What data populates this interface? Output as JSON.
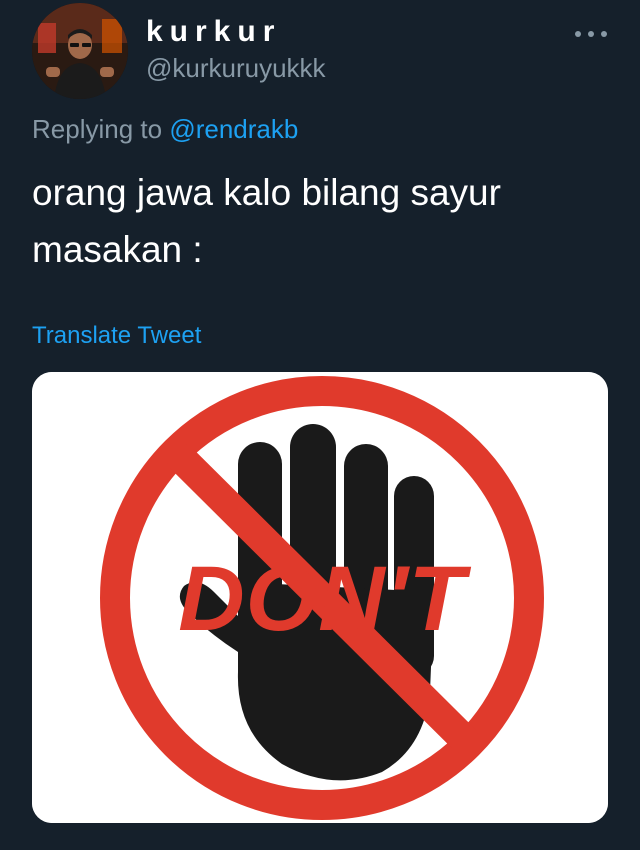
{
  "tweet": {
    "display_name": "kurkur",
    "handle": "@kurkuruyukkk",
    "replying_prefix": "Replying to ",
    "replying_to": "@rendrakb",
    "text_line1": "orang jawa kalo bilang sayur",
    "text_line2": "masakan :",
    "translate_label": "Translate Tweet",
    "media": {
      "sign_text": "DON'T",
      "icon": "stop-hand-prohibition-sign"
    }
  },
  "icons": {
    "more": "more-dots-icon",
    "avatar": "user-avatar"
  },
  "colors": {
    "background": "#15202b",
    "text_primary": "#ffffff",
    "text_secondary": "#8899a6",
    "accent": "#1da1f2",
    "sign_red": "#e03a2c",
    "hand": "#1a1a1a"
  }
}
